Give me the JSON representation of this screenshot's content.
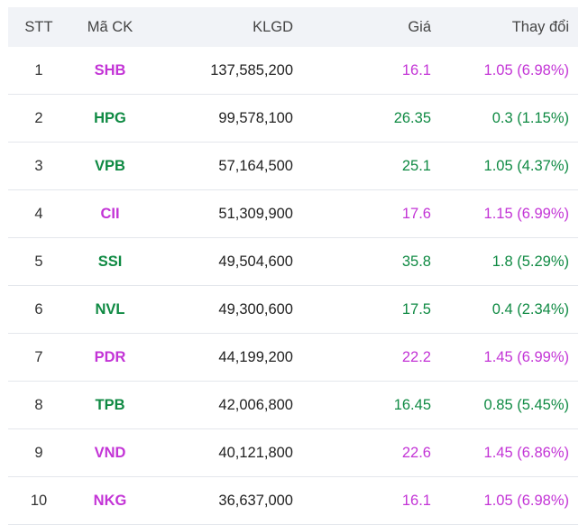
{
  "colors": {
    "ceiling": "#c334d6",
    "up": "#0f8a43"
  },
  "headers": [
    "STT",
    "Mã CK",
    "KLGD",
    "Giá",
    "Thay đổi"
  ],
  "rows": [
    {
      "stt": "1",
      "symbol": "SHB",
      "volume": "137,585,200",
      "price": "16.1",
      "change": "1.05 (6.98%)",
      "status": "ceiling"
    },
    {
      "stt": "2",
      "symbol": "HPG",
      "volume": "99,578,100",
      "price": "26.35",
      "change": "0.3 (1.15%)",
      "status": "up"
    },
    {
      "stt": "3",
      "symbol": "VPB",
      "volume": "57,164,500",
      "price": "25.1",
      "change": "1.05 (4.37%)",
      "status": "up"
    },
    {
      "stt": "4",
      "symbol": "CII",
      "volume": "51,309,900",
      "price": "17.6",
      "change": "1.15 (6.99%)",
      "status": "ceiling"
    },
    {
      "stt": "5",
      "symbol": "SSI",
      "volume": "49,504,600",
      "price": "35.8",
      "change": "1.8 (5.29%)",
      "status": "up"
    },
    {
      "stt": "6",
      "symbol": "NVL",
      "volume": "49,300,600",
      "price": "17.5",
      "change": "0.4 (2.34%)",
      "status": "up"
    },
    {
      "stt": "7",
      "symbol": "PDR",
      "volume": "44,199,200",
      "price": "22.2",
      "change": "1.45 (6.99%)",
      "status": "ceiling"
    },
    {
      "stt": "8",
      "symbol": "TPB",
      "volume": "42,006,800",
      "price": "16.45",
      "change": "0.85 (5.45%)",
      "status": "up"
    },
    {
      "stt": "9",
      "symbol": "VND",
      "volume": "40,121,800",
      "price": "22.6",
      "change": "1.45 (6.86%)",
      "status": "ceiling"
    },
    {
      "stt": "10",
      "symbol": "NKG",
      "volume": "36,637,000",
      "price": "16.1",
      "change": "1.05 (6.98%)",
      "status": "ceiling"
    }
  ]
}
